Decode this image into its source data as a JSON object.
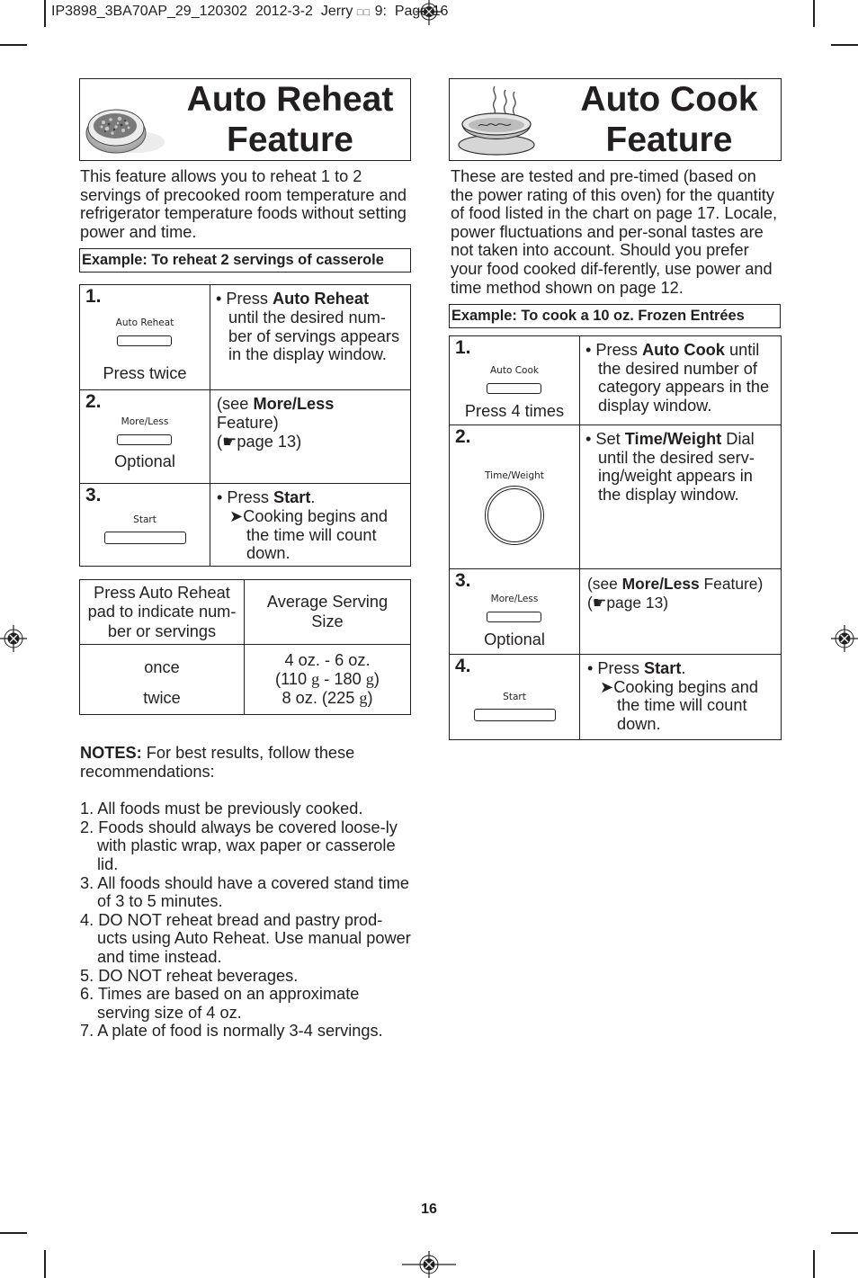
{
  "slug": {
    "job": "IP3898_3BA70AP_29_120302",
    "date": "2012-3-2",
    "author": "Jerry",
    "garbled": "□□",
    "time": "9:",
    "page": "Page 16"
  },
  "auto_reheat": {
    "title_line1": "Auto Reheat",
    "title_line2": "Feature",
    "image_icon": "food-plate-icon",
    "intro": "This feature allows you to reheat 1 to 2 servings of precooked room temperature and refrigerator temperature foods without setting power and time.",
    "example": "Example: To reheat  2 servings of casserole",
    "steps": [
      {
        "number": "1.",
        "pad_label": "Auto Reheat",
        "under_note": "Press twice",
        "bullet": "• Press ",
        "bold": "Auto Reheat",
        "rest": "until the desired num-ber of servings appears in the display window."
      },
      {
        "number": "2.",
        "pad_label": "More/Less",
        "under_note": "Optional",
        "prefix": "(see ",
        "bold": "More/Less",
        "rest": "Feature)",
        "page_ref_icon": "pointing-hand-icon",
        "page_ref": "page 13)"
      },
      {
        "number": "3.",
        "pad_label": "Start",
        "bullet": "• Press ",
        "bold": "Start",
        "after_bold": ".",
        "arrow_icon": "arrow-right-icon",
        "result": "Cooking begins and the time will count down."
      }
    ],
    "serving_table": {
      "headers": [
        "Press Auto Reheat pad to indicate num-ber or servings",
        "Average Serving Size"
      ],
      "rows": [
        {
          "press": "once",
          "size_line1": "4 oz. - 6 oz.",
          "size_line2_a": "(110 ",
          "unit": "g",
          "size_line2_b": " - 180 ",
          "size_line2_c": ")"
        },
        {
          "press": "twice",
          "size_a": "8 oz. (225 ",
          "unit": "g",
          "size_b": ")"
        }
      ]
    },
    "notes": {
      "label": "NOTES:",
      "intro": " For best results, follow these recommendations:",
      "items": [
        "1. All foods must be previously cooked.",
        "2. Foods should always be covered loose-ly with plastic wrap, wax paper or casserole lid.",
        "3. All foods should have a covered stand time of 3 to 5 minutes.",
        "4. DO NOT reheat bread and pastry prod-ucts using Auto Reheat. Use manual power and time instead.",
        "5. DO NOT reheat beverages.",
        "6. Times are based on an approximate serving size of 4 oz.",
        "7. A plate of food is normally 3-4 servings."
      ]
    }
  },
  "auto_cook": {
    "title_line1": "Auto Cook",
    "title_line2": "Feature",
    "image_icon": "soup-bowl-icon",
    "intro": "These are tested and pre-timed (based on the power rating of this oven) for the quantity of food listed in the chart on page 17. Locale, power fluctuations and per-sonal tastes are not taken into account. Should you prefer your food cooked dif-ferently, use power and time method shown on page 12.",
    "example": "Example: To cook a 10 oz. Frozen Entrées",
    "steps": [
      {
        "number": "1.",
        "pad_label": "Auto Cook",
        "under_note": "Press 4 times",
        "bullet": "• Press ",
        "bold": "Auto Cook",
        "rest": " until the desired number of category appears in the display window."
      },
      {
        "number": "2.",
        "pad_label": "Time/Weight",
        "bullet": "• Set ",
        "bold": "Time/Weight",
        "rest": " Dial until the desired serv-ing/weight appears in the display window."
      },
      {
        "number": "3.",
        "pad_label": "More/Less",
        "under_note": "Optional",
        "prefix": "(see ",
        "bold": "More/Less",
        "rest": " Feature)",
        "page_ref_icon": "pointing-hand-icon",
        "page_ref": "page 13)"
      },
      {
        "number": "4.",
        "pad_label": "Start",
        "bullet": "• Press ",
        "bold": "Start",
        "after_bold": ".",
        "arrow_icon": "arrow-right-icon",
        "result": "Cooking begins and the time will count down."
      }
    ]
  },
  "page_number": "16",
  "glyphs": {
    "hand": "☛",
    "arrow": "➤",
    "open_paren": "("
  }
}
